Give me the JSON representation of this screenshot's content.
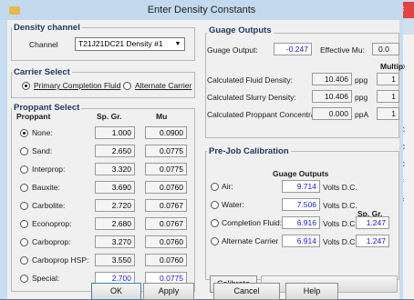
{
  "window": {
    "title": "Enter Density Constants"
  },
  "density_channel": {
    "group_title": "Density channel",
    "channel_label": "Channel",
    "channel_value": "T21J21DC21  Density #1"
  },
  "carrier_select": {
    "group_title": "Carrier Select",
    "primary_label": "Primary Completion Fluid",
    "alternate_label": "Alternate Carrier",
    "selected": "primary"
  },
  "proppant_select": {
    "group_title": "Proppant Select",
    "headers": {
      "proppant": "Proppant",
      "sp_gr": "Sp. Gr.",
      "mu": "Mu"
    },
    "rows": [
      {
        "name": "None:",
        "sp_gr": "1.000",
        "mu": "0.0900",
        "selected": true,
        "editable": false
      },
      {
        "name": "Sand:",
        "sp_gr": "2.650",
        "mu": "0.0775",
        "selected": false,
        "editable": false
      },
      {
        "name": "Interprop:",
        "sp_gr": "3.320",
        "mu": "0.0775",
        "selected": false,
        "editable": false
      },
      {
        "name": "Bauxite:",
        "sp_gr": "3.690",
        "mu": "0.0760",
        "selected": false,
        "editable": false
      },
      {
        "name": "Carbolite:",
        "sp_gr": "2.720",
        "mu": "0.0767",
        "selected": false,
        "editable": false
      },
      {
        "name": "Econoprop:",
        "sp_gr": "2.680",
        "mu": "0.0767",
        "selected": false,
        "editable": false
      },
      {
        "name": "Carboprop:",
        "sp_gr": "3.270",
        "mu": "0.0760",
        "selected": false,
        "editable": false
      },
      {
        "name": "Carboprop HSP:",
        "sp_gr": "3.550",
        "mu": "0.0760",
        "selected": false,
        "editable": false
      },
      {
        "name": "Special:",
        "sp_gr": "2.700",
        "mu": "0.0775",
        "selected": false,
        "editable": true
      }
    ]
  },
  "guage_outputs": {
    "group_title": "Guage Outputs",
    "guage_output_label": "Guage Output:",
    "guage_output_value": "-0.247",
    "effective_mu_label": "Effective Mu:",
    "effective_mu_value": "0.0",
    "multip_header": "Multip",
    "calculated": [
      {
        "label": "Calculated Fluid Density:",
        "value": "10.406",
        "unit": "ppg",
        "extra": "1"
      },
      {
        "label": "Calculated Slurry Density:",
        "value": "10.406",
        "unit": "ppg",
        "extra": "1"
      },
      {
        "label": "Calculated Proppant Concentration:",
        "value": "0.000",
        "unit": "ppA",
        "extra": "1"
      }
    ]
  },
  "prejob_calibration": {
    "group_title": "Pre-Job Calibration",
    "guage_outputs_header": "Guage Outputs",
    "sp_gr_header": "Sp. Gr.",
    "unit": "Volts D.C.",
    "rows": [
      {
        "name": "Air:",
        "value": "9.714",
        "sp_gr": ""
      },
      {
        "name": "Water:",
        "value": "7.506",
        "sp_gr": ""
      },
      {
        "name": "Completion Fluid:",
        "value": "6.916",
        "sp_gr": "1.247"
      },
      {
        "name": "Alternate Carrier",
        "value": "6.914",
        "sp_gr": "1.247"
      }
    ],
    "calibrate_label": "Calibrate"
  },
  "buttons": {
    "ok": "OK",
    "apply": "Apply",
    "cancel": "Cancel",
    "help": "Help"
  },
  "background_left_snippets": [
    "ce",
    "3f",
    ".0",
    ".0",
    ".0",
    ".0"
  ],
  "background_right": {
    "close_glyph": "×",
    "letters": [
      "D",
      "",
      "C",
      "C",
      "C",
      "×",
      "F"
    ]
  }
}
